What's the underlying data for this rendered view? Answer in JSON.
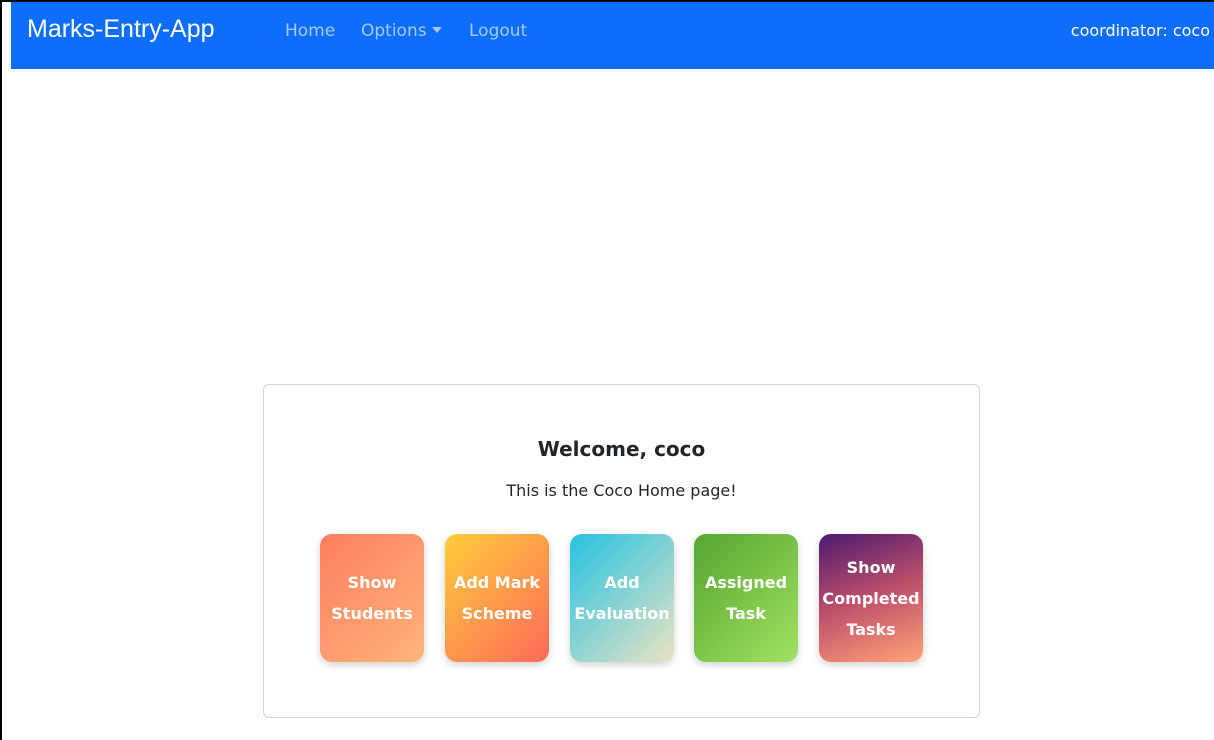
{
  "navbar": {
    "brand": "Marks-Entry-App",
    "links": {
      "home": "Home",
      "options": "Options",
      "logout": "Logout"
    },
    "user": "coordinator: coco",
    "background_color": "#0d6efd"
  },
  "main": {
    "welcome": "Welcome, coco",
    "subtitle": "This is the Coco Home page!",
    "tiles": [
      {
        "label": "Show\nStudents",
        "gradient": [
          "#ff7e5f",
          "#feb47b"
        ]
      },
      {
        "label": "Add Mark\nScheme",
        "gradient": [
          "#ffcd3c",
          "#ff6a5a"
        ]
      },
      {
        "label": "Add\nEvaluation",
        "gradient": [
          "#26c2e2",
          "#e9e3c3"
        ]
      },
      {
        "label": "Assigned\nTask",
        "gradient": [
          "#55a630",
          "#a1e162"
        ]
      },
      {
        "label": "Show\nCompleted\nTasks",
        "gradient": [
          "#4b1a6e",
          "#c0506b",
          "#ffa477"
        ]
      }
    ]
  }
}
